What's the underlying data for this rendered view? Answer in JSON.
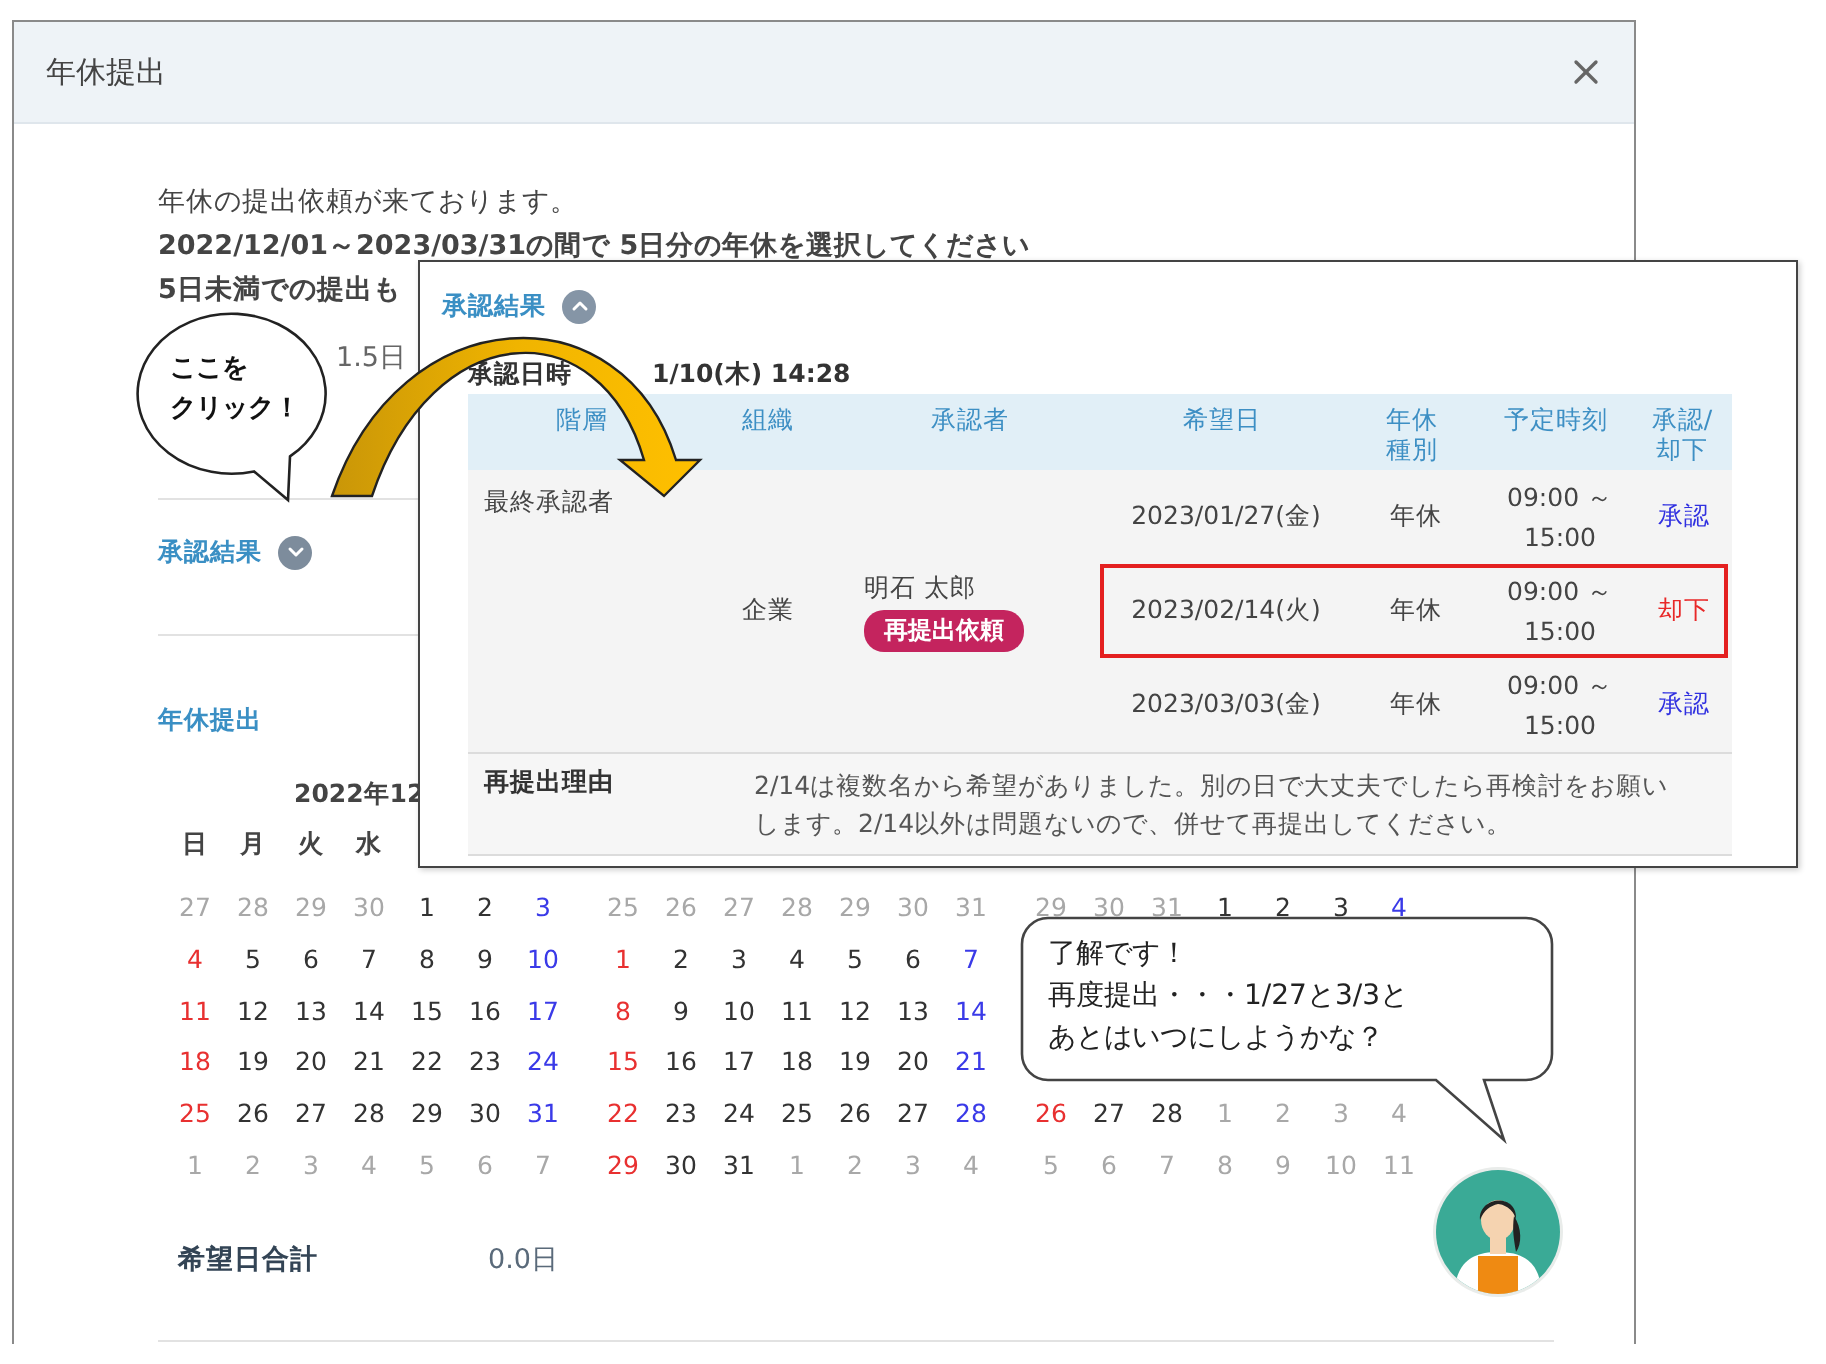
{
  "dialog": {
    "title": "年休提出",
    "intro": [
      "年休の提出依頼が来ております。",
      "**2022/12/01～2023/03/31**の間で **5日分**の年休を選択してください",
      "5日未満での提出も"
    ],
    "partial_value": "1.5日",
    "result_toggle": {
      "label": "承認結果",
      "expanded": false
    },
    "section_label": "年休提出",
    "calendars": [
      {
        "title": "2022年12",
        "weekdays": [
          "日",
          "月",
          "火",
          "水"
        ],
        "weeks": [
          [
            {
              "day": "27",
              "kind": "other"
            },
            {
              "day": "28",
              "kind": "other"
            },
            {
              "day": "29",
              "kind": "other"
            },
            {
              "day": "30",
              "kind": "other"
            },
            {
              "day": "1",
              "kind": "weekday"
            },
            {
              "day": "2",
              "kind": "weekday"
            },
            {
              "day": "3",
              "kind": "sat"
            }
          ],
          [
            {
              "day": "4",
              "kind": "sun"
            },
            {
              "day": "5",
              "kind": "weekday"
            },
            {
              "day": "6",
              "kind": "weekday"
            },
            {
              "day": "7",
              "kind": "weekday"
            },
            {
              "day": "8",
              "kind": "weekday"
            },
            {
              "day": "9",
              "kind": "weekday"
            },
            {
              "day": "10",
              "kind": "sat"
            }
          ],
          [
            {
              "day": "11",
              "kind": "sun"
            },
            {
              "day": "12",
              "kind": "weekday"
            },
            {
              "day": "13",
              "kind": "weekday"
            },
            {
              "day": "14",
              "kind": "weekday"
            },
            {
              "day": "15",
              "kind": "weekday"
            },
            {
              "day": "16",
              "kind": "weekday"
            },
            {
              "day": "17",
              "kind": "sat"
            }
          ],
          [
            {
              "day": "18",
              "kind": "sun"
            },
            {
              "day": "19",
              "kind": "weekday"
            },
            {
              "day": "20",
              "kind": "weekday"
            },
            {
              "day": "21",
              "kind": "weekday"
            },
            {
              "day": "22",
              "kind": "weekday"
            },
            {
              "day": "23",
              "kind": "weekday"
            },
            {
              "day": "24",
              "kind": "sat"
            }
          ],
          [
            {
              "day": "25",
              "kind": "sun"
            },
            {
              "day": "26",
              "kind": "weekday"
            },
            {
              "day": "27",
              "kind": "weekday"
            },
            {
              "day": "28",
              "kind": "weekday"
            },
            {
              "day": "29",
              "kind": "weekday"
            },
            {
              "day": "30",
              "kind": "weekday"
            },
            {
              "day": "31",
              "kind": "sat"
            }
          ],
          [
            {
              "day": "1",
              "kind": "other"
            },
            {
              "day": "2",
              "kind": "other"
            },
            {
              "day": "3",
              "kind": "other"
            },
            {
              "day": "4",
              "kind": "other"
            },
            {
              "day": "5",
              "kind": "other"
            },
            {
              "day": "6",
              "kind": "other"
            },
            {
              "day": "7",
              "kind": "other"
            }
          ]
        ]
      },
      {
        "weeks": [
          [
            {
              "day": "25",
              "kind": "other"
            },
            {
              "day": "26",
              "kind": "other"
            },
            {
              "day": "27",
              "kind": "other"
            },
            {
              "day": "28",
              "kind": "other"
            },
            {
              "day": "29",
              "kind": "other"
            },
            {
              "day": "30",
              "kind": "other"
            },
            {
              "day": "31",
              "kind": "other"
            }
          ],
          [
            {
              "day": "1",
              "kind": "sun"
            },
            {
              "day": "2",
              "kind": "weekday"
            },
            {
              "day": "3",
              "kind": "weekday"
            },
            {
              "day": "4",
              "kind": "weekday"
            },
            {
              "day": "5",
              "kind": "weekday"
            },
            {
              "day": "6",
              "kind": "weekday"
            },
            {
              "day": "7",
              "kind": "sat"
            }
          ],
          [
            {
              "day": "8",
              "kind": "sun"
            },
            {
              "day": "9",
              "kind": "weekday"
            },
            {
              "day": "10",
              "kind": "weekday"
            },
            {
              "day": "11",
              "kind": "weekday"
            },
            {
              "day": "12",
              "kind": "weekday"
            },
            {
              "day": "13",
              "kind": "weekday"
            },
            {
              "day": "14",
              "kind": "sat"
            }
          ],
          [
            {
              "day": "15",
              "kind": "sun"
            },
            {
              "day": "16",
              "kind": "weekday"
            },
            {
              "day": "17",
              "kind": "weekday"
            },
            {
              "day": "18",
              "kind": "weekday"
            },
            {
              "day": "19",
              "kind": "weekday"
            },
            {
              "day": "20",
              "kind": "weekday"
            },
            {
              "day": "21",
              "kind": "sat"
            }
          ],
          [
            {
              "day": "22",
              "kind": "sun"
            },
            {
              "day": "23",
              "kind": "weekday"
            },
            {
              "day": "24",
              "kind": "weekday"
            },
            {
              "day": "25",
              "kind": "weekday"
            },
            {
              "day": "26",
              "kind": "weekday"
            },
            {
              "day": "27",
              "kind": "weekday"
            },
            {
              "day": "28",
              "kind": "sat"
            }
          ],
          [
            {
              "day": "29",
              "kind": "sun"
            },
            {
              "day": "30",
              "kind": "weekday"
            },
            {
              "day": "31",
              "kind": "weekday"
            },
            {
              "day": "1",
              "kind": "other"
            },
            {
              "day": "2",
              "kind": "other"
            },
            {
              "day": "3",
              "kind": "other"
            },
            {
              "day": "4",
              "kind": "other"
            }
          ]
        ]
      },
      {
        "weeks": [
          [
            {
              "day": "29",
              "kind": "other"
            },
            {
              "day": "30",
              "kind": "other"
            },
            {
              "day": "31",
              "kind": "other"
            },
            {
              "day": "1",
              "kind": "weekday"
            },
            {
              "day": "2",
              "kind": "weekday"
            },
            {
              "day": "3",
              "kind": "weekday"
            },
            {
              "day": "4",
              "kind": "sat"
            }
          ]
        ],
        "speech_bubble": {
          "lines": [
            "了解です！",
            "再度提出・・・1/27と3/3と",
            "あとはいつにしようかな？"
          ]
        },
        "weeks_below_bubble": [
          [
            {
              "day": "26",
              "kind": "sun"
            },
            {
              "day": "27",
              "kind": "weekday"
            },
            {
              "day": "28",
              "kind": "weekday"
            },
            {
              "day": "1",
              "kind": "other"
            },
            {
              "day": "2",
              "kind": "other"
            },
            {
              "day": "3",
              "kind": "other"
            },
            {
              "day": "4",
              "kind": "other"
            }
          ],
          [
            {
              "day": "5",
              "kind": "other"
            },
            {
              "day": "6",
              "kind": "other"
            },
            {
              "day": "7",
              "kind": "other"
            },
            {
              "day": "8",
              "kind": "other"
            },
            {
              "day": "9",
              "kind": "other"
            },
            {
              "day": "10",
              "kind": "other"
            },
            {
              "day": "11",
              "kind": "other"
            }
          ]
        ]
      }
    ],
    "total": {
      "label": "希望日合計",
      "value": "0.0日"
    }
  },
  "callout": {
    "lines": [
      "ここを",
      "クリック！"
    ]
  },
  "popup": {
    "toggle": {
      "label": "承認結果",
      "expanded": true
    },
    "approved_at_label": "承認日時",
    "approved_at_value": "1/10(木) 14:28",
    "columns": [
      "階層",
      "組織",
      "承認者",
      "希望日",
      "年休種別",
      "予定時刻",
      "承認/却下"
    ],
    "tier": "最終承認者",
    "organization": "企業",
    "approver": "明石 太郎",
    "badge": "再提出依頼",
    "requests": [
      {
        "date": "2023/01/27(金)",
        "type": "年休",
        "time": "09:00 ～ 15:00",
        "status": "承認",
        "kind": "approved",
        "highlighted": false
      },
      {
        "date": "2023/02/14(火)",
        "type": "年休",
        "time": "09:00 ～ 15:00",
        "status": "却下",
        "kind": "rejected",
        "highlighted": true
      },
      {
        "date": "2023/03/03(金)",
        "type": "年休",
        "time": "09:00 ～ 15:00",
        "status": "承認",
        "kind": "approved",
        "highlighted": false
      }
    ],
    "reason_label": "再提出理由",
    "reason": "2/14は複数名から希望がありました。別の日で大丈夫でしたら再検討をお願いします。2/14以外は問題ないので、併せて再提出してください。"
  }
}
